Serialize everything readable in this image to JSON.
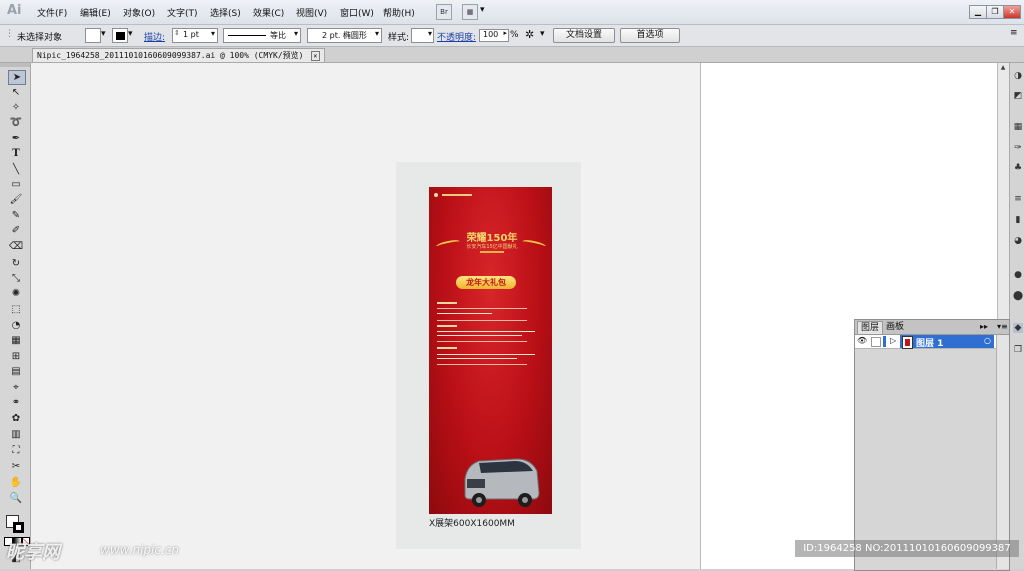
{
  "app": {
    "logo": "Ai"
  },
  "menu": [
    "文件(F)",
    "编辑(E)",
    "对象(O)",
    "文字(T)",
    "选择(S)",
    "效果(C)",
    "视图(V)",
    "窗口(W)",
    "帮助(H)"
  ],
  "toolbar_icons": {
    "bridge": "Br"
  },
  "control": {
    "selection_label": "未选择对象",
    "stroke_label": "描边:",
    "stroke_weight": "1 pt",
    "profile_label": "等比",
    "brush_label": "2 pt. 椭圆形",
    "style_label": "样式:",
    "opacity_label": "不透明度:",
    "opacity_value": "100",
    "opacity_unit": "%",
    "doc_setup": "文档设置",
    "prefs": "首选项"
  },
  "document": {
    "tab_title": "Nipic_1964258_20111010160609099387.ai @ 100% (CMYK/预览)"
  },
  "artwork": {
    "badge_title": "荣耀150年",
    "badge_sub": "长安汽车15亿中国献礼",
    "gift": "龙年大礼包",
    "dimension_label": "X展架600X1600MM"
  },
  "layers_panel": {
    "tabs": [
      "图层",
      "画板"
    ],
    "layer_name": "图层 1"
  },
  "watermark": {
    "site": "昵享网",
    "url": "www.nipic.cn",
    "id_text": "ID:1964258 NO:20111010160609099387"
  },
  "colors": {
    "poster_red": "#b90f16",
    "gold": "#f0c64a",
    "selection": "#2f6fd2"
  }
}
